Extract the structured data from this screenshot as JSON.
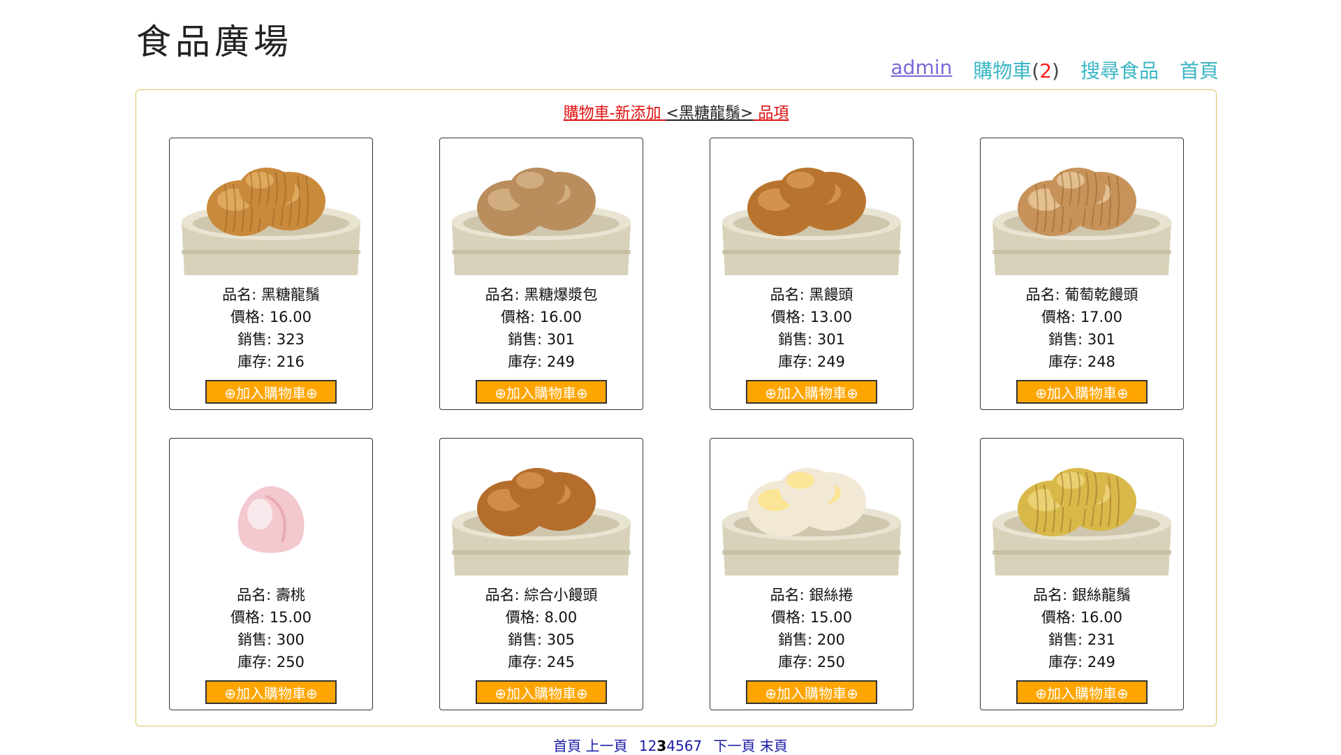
{
  "header": {
    "title": "食品廣場",
    "nav": {
      "admin": "admin",
      "cart_label": "購物車",
      "cart_open": "(",
      "cart_count": "2",
      "cart_close": ")",
      "search": "搜尋食品",
      "home": "首頁"
    }
  },
  "notice": {
    "prefix": "購物車-新添加 ",
    "item": "<黑糖龍鬚>",
    "suffix": " 品項"
  },
  "labels": {
    "name": "品名: ",
    "price": "價格: ",
    "sales": "銷售: ",
    "stock": "庫存: ",
    "add_button": "⊕加入購物車⊕"
  },
  "products": [
    {
      "name": "黑糖龍鬚",
      "price": "16.00",
      "sales": "323",
      "stock": "216",
      "image": "dark-twisted-bun-steamer"
    },
    {
      "name": "黑糖爆漿包",
      "price": "16.00",
      "sales": "301",
      "stock": "249",
      "image": "brown-filled-buns-steamer"
    },
    {
      "name": "黑饅頭",
      "price": "13.00",
      "sales": "301",
      "stock": "249",
      "image": "brown-mantou-steamer"
    },
    {
      "name": "葡萄乾饅頭",
      "price": "17.00",
      "sales": "301",
      "stock": "248",
      "image": "raisin-swirl-bun-steamer"
    },
    {
      "name": "壽桃",
      "price": "15.00",
      "sales": "300",
      "stock": "250",
      "image": "pink-peach-bun"
    },
    {
      "name": "綜合小饅頭",
      "price": "8.00",
      "sales": "305",
      "stock": "245",
      "image": "small-brown-buns-steamer"
    },
    {
      "name": "銀絲捲",
      "price": "15.00",
      "sales": "200",
      "stock": "250",
      "image": "silver-thread-roll-steamer"
    },
    {
      "name": "銀絲龍鬚",
      "price": "16.00",
      "sales": "231",
      "stock": "249",
      "image": "golden-twisted-bun-steamer"
    }
  ],
  "pagination": {
    "first": "首頁",
    "prev": "上一頁",
    "pages": [
      "1",
      "2",
      "3",
      "4",
      "5",
      "6",
      "7"
    ],
    "current": "3",
    "next": "下一頁",
    "last": "末頁"
  },
  "colors": {
    "accent_teal": "#3bb6c6",
    "admin_purple": "#7b68d6",
    "button_orange": "#ffa500",
    "notice_red": "#e01010",
    "panel_border": "#e0c36a",
    "pager_blue": "#1a1aa6"
  }
}
